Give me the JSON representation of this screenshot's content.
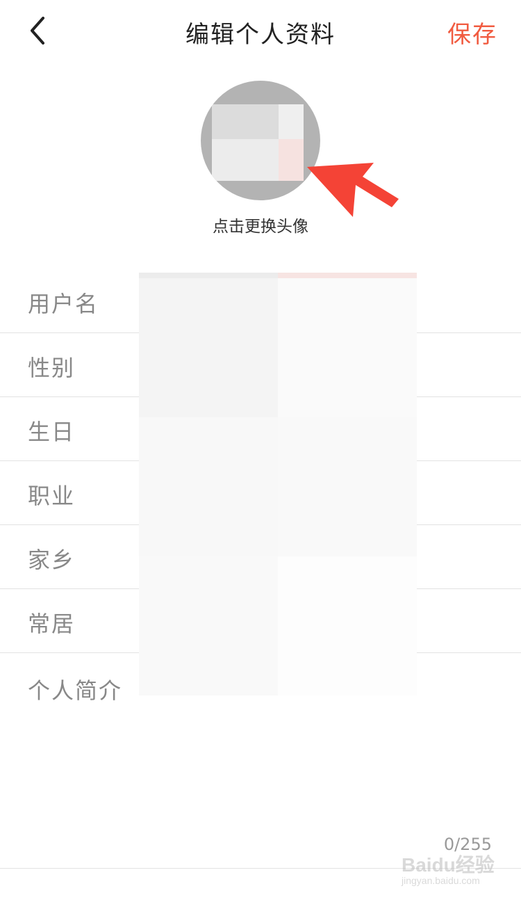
{
  "header": {
    "title": "编辑个人资料",
    "save_label": "保存",
    "back_icon": "chevron-left-icon"
  },
  "avatar": {
    "hint": "点击更换头像",
    "arrow_color": "#f44336"
  },
  "form": {
    "fields": [
      {
        "label": "用户名"
      },
      {
        "label": "性别"
      },
      {
        "label": "生日"
      },
      {
        "label": "职业"
      },
      {
        "label": "家乡"
      },
      {
        "label": "常居"
      },
      {
        "label": "个人简介"
      }
    ],
    "bio_counter": "0/255"
  },
  "watermark": {
    "brand": "Baidu经验",
    "url": "jingyan.baidu.com"
  },
  "colors": {
    "accent": "#f15b40",
    "label": "#888888",
    "divider": "#e2e2e2"
  }
}
